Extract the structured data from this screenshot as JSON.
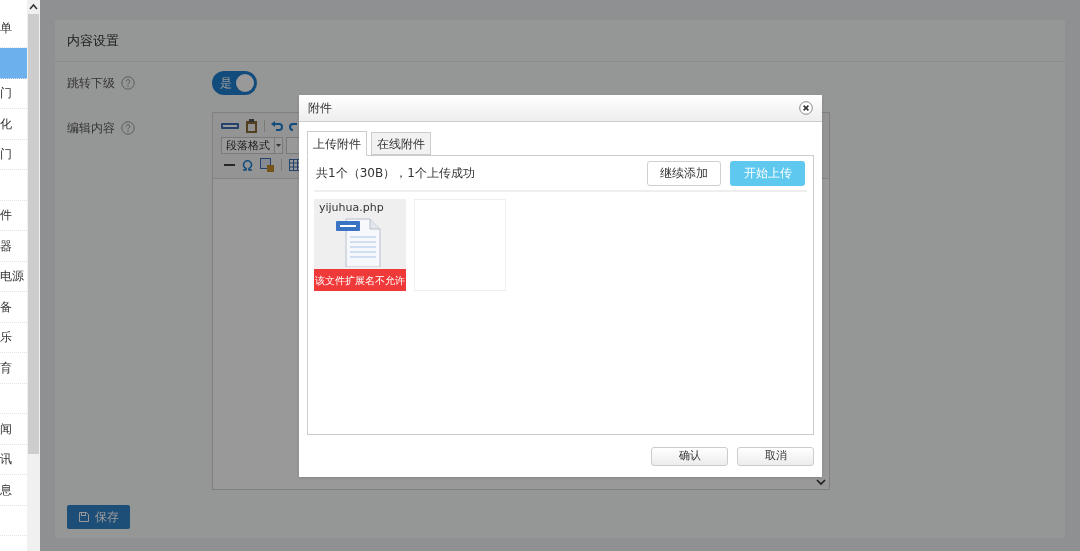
{
  "sidebar": {
    "items": [
      {
        "label": "单",
        "selected": false
      },
      {
        "selected": true
      },
      {
        "label": "门",
        "selected": false
      },
      {
        "label": "化",
        "selected": false
      },
      {
        "label": "门",
        "selected": false
      },
      {
        "selected": false
      },
      {
        "label": "件",
        "selected": false
      },
      {
        "label": "器",
        "selected": false
      },
      {
        "label": "电源",
        "selected": false
      },
      {
        "label": "备",
        "selected": false
      },
      {
        "label": "乐",
        "selected": false
      },
      {
        "label": "育",
        "selected": false
      },
      {
        "selected": false
      },
      {
        "label": "闻",
        "selected": false
      },
      {
        "label": "讯",
        "selected": false
      },
      {
        "label": "息",
        "selected": false
      },
      {
        "selected": false
      }
    ]
  },
  "page": {
    "section_title": "内容设置",
    "fields": [
      {
        "kind": "toggle",
        "label": "跳转下级",
        "on": true,
        "toggle_text": "是"
      },
      {
        "kind": "editor",
        "label": "编辑内容"
      }
    ],
    "editor": {
      "format_select": "段落格式"
    },
    "save_button": "保存"
  },
  "dialog": {
    "title": "附件",
    "tabs": [
      {
        "label": "上传附件",
        "selected": true
      },
      {
        "label": "在线附件",
        "selected": false
      }
    ],
    "status": "共1个（30B），1个上传成功",
    "add_button": "继续添加",
    "upload_button": "开始上传",
    "files": [
      {
        "name": "yijuhua.php",
        "error": "该文件扩展名不允许"
      }
    ],
    "ok_button": "确认",
    "cancel_button": "取消"
  }
}
